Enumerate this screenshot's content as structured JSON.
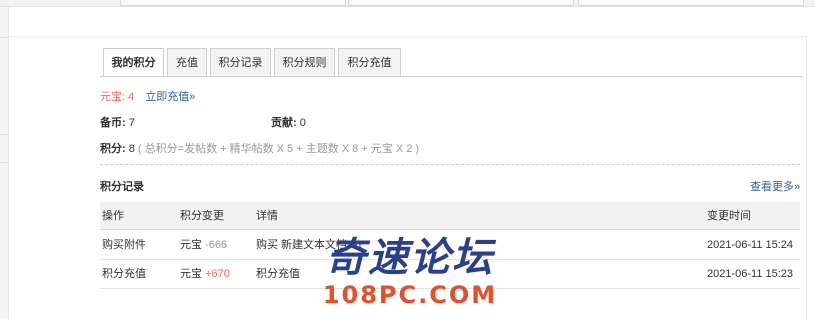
{
  "tabs": [
    {
      "label": "我的积分",
      "active": true
    },
    {
      "label": "充值",
      "active": false
    },
    {
      "label": "积分记录",
      "active": false
    },
    {
      "label": "积分规则",
      "active": false
    },
    {
      "label": "积分充值",
      "active": false
    }
  ],
  "summary": {
    "yuanbao_label": "元宝:",
    "yuanbao_value": "4",
    "recharge_link": "立即充值»",
    "coins_label": "备币:",
    "coins_value": "7",
    "contrib_label": "贡献:",
    "contrib_value": "0",
    "points_label": "积分:",
    "points_value": "8",
    "points_formula": "( 总积分=发帖数 + 精华帖数 X 5 + 主题数 X 8 + 元宝 X 2 )"
  },
  "records": {
    "title": "积分记录",
    "see_more": "查看更多»",
    "columns": [
      "操作",
      "积分变更",
      "详情",
      "变更时间"
    ],
    "rows": [
      {
        "action": "购买附件",
        "change_type": "元宝",
        "change_value": "-666",
        "detail": "购买 新建文本文档.txt",
        "time": "2021-06-11 15:24"
      },
      {
        "action": "积分充值",
        "change_type": "元宝",
        "change_value": "+670",
        "detail": "积分充值",
        "time": "2021-06-11 15:23"
      }
    ]
  },
  "watermark": {
    "cn": "奇速论坛",
    "en": "108PC.COM"
  },
  "colors": {
    "accent_orange": "#f26c4f",
    "link_blue": "#336699",
    "watermark_blue": "#2b3f8f",
    "watermark_orange": "#e4502c"
  }
}
